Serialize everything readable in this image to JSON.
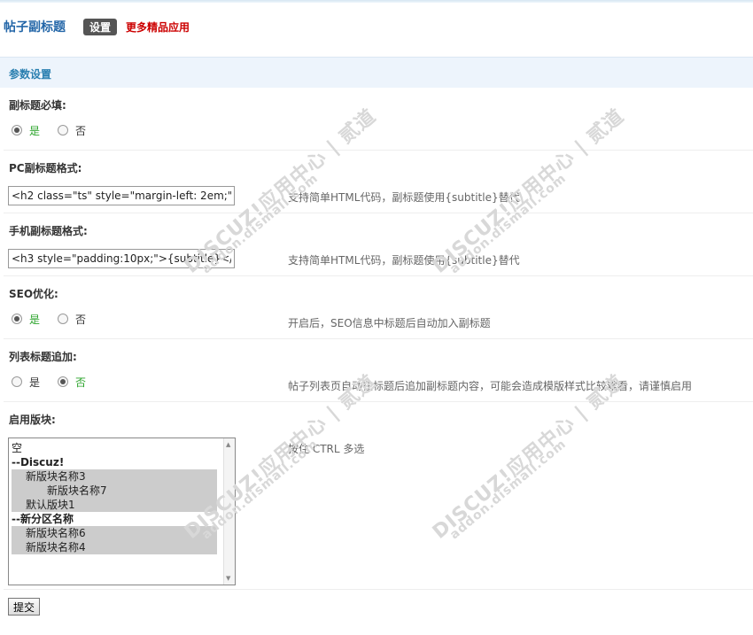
{
  "header": {
    "title": "帖子副标题",
    "settings_label": "设置",
    "more_link": "更多精品应用"
  },
  "section": {
    "title": "参数设置"
  },
  "fields": {
    "subtitle_required": {
      "label": "副标题必填:",
      "options": [
        "是",
        "否"
      ],
      "selected": "是"
    },
    "pc_format": {
      "label": "PC副标题格式:",
      "value": "<h2 class=\"ts\" style=\"margin-left: 2em;\"",
      "hint": "支持简单HTML代码，副标题使用{subtitle}替代"
    },
    "mobile_format": {
      "label": "手机副标题格式:",
      "value": "<h3 style=\"padding:10px;\">{subtitle}</",
      "hint": "支持简单HTML代码，副标题使用{subtitle}替代"
    },
    "seo": {
      "label": "SEO优化:",
      "options": [
        "是",
        "否"
      ],
      "selected": "是",
      "hint": "开启后，SEO信息中标题后自动加入副标题"
    },
    "list_title_append": {
      "label": "列表标题追加:",
      "options": [
        "是",
        "否"
      ],
      "selected": "否",
      "hint": "帖子列表页自动在标题后追加副标题内容，可能会造成模版样式比较难看，请谨慎启用"
    },
    "enable_forums": {
      "label": "启用版块:",
      "hint": "按住 CTRL 多选",
      "options": [
        {
          "label": "空",
          "selected": false
        },
        {
          "label": "--Discuz!",
          "selected": false
        },
        {
          "label": "新版块名称3",
          "selected": true
        },
        {
          "label": "新版块名称7",
          "selected": true
        },
        {
          "label": "默认版块1",
          "selected": true
        },
        {
          "label": "--新分区名称",
          "selected": false
        },
        {
          "label": "新版块名称6",
          "selected": true
        },
        {
          "label": "新版块名称4",
          "selected": true
        }
      ]
    }
  },
  "submit_label": "提交",
  "watermark": {
    "text": "DISCUZ!应用中心 | 贰道",
    "subtext": "addon.dismall.com"
  }
}
